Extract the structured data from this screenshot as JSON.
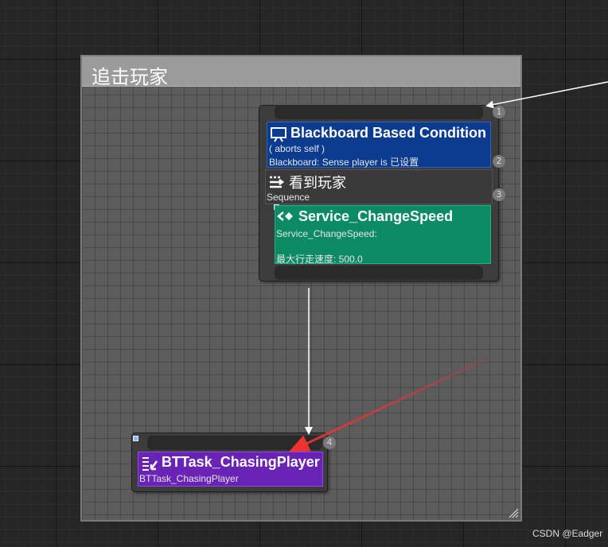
{
  "comment": {
    "title": "追击玩家"
  },
  "nodes": {
    "decorator": {
      "title": "Blackboard Based Condition",
      "line1": "( aborts self )",
      "line2": "Blackboard: Sense player is 已设置",
      "index": "2",
      "icon": "blackboard-icon",
      "color": "#0b3c8f"
    },
    "composite": {
      "index": "1"
    },
    "sequence": {
      "title": "看到玩家",
      "subtitle": "Sequence",
      "index": "3",
      "icon": "sequence-icon"
    },
    "service": {
      "title": "Service_ChangeSpeed",
      "line1": "Service_ChangeSpeed:",
      "line2": "最大行走速度: 500.0",
      "icon": "service-icon",
      "color": "#0b8a64"
    },
    "task": {
      "title": "BTTask_ChasingPlayer",
      "subtitle": "BTTask_ChasingPlayer",
      "index": "4",
      "icon": "task-icon",
      "color": "#6a24b5"
    }
  },
  "annotation": {
    "arrow_color": "#ee3333"
  },
  "watermark": "CSDN @Eadger"
}
